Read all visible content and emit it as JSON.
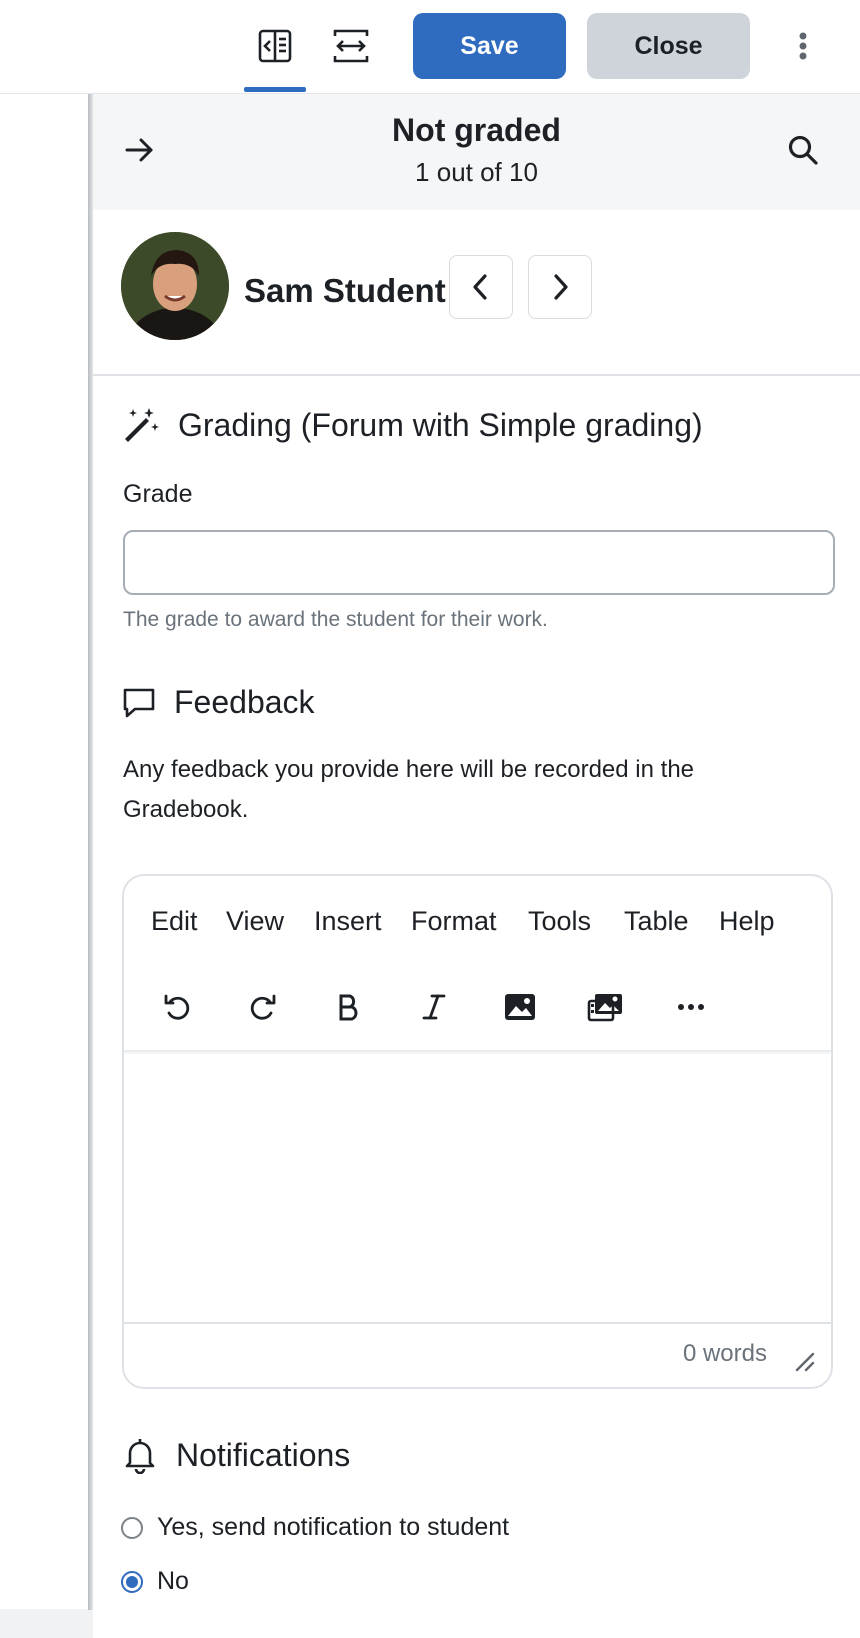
{
  "topbar": {
    "save_label": "Save",
    "close_label": "Close"
  },
  "panel": {
    "status_title": "Not graded",
    "status_sub": "1 out of 10",
    "student_name": "Sam Student"
  },
  "grading": {
    "heading": "Grading (Forum with Simple grading)",
    "grade_label": "Grade",
    "grade_value": "",
    "grade_help": "The grade to award the student for their work."
  },
  "feedback": {
    "heading": "Feedback",
    "description": "Any feedback you provide here will be recorded in the Gradebook.",
    "menu": [
      "Edit",
      "View",
      "Insert",
      "Format",
      "Tools",
      "Table",
      "Help"
    ],
    "tools": [
      "undo-icon",
      "redo-icon",
      "bold-icon",
      "italic-icon",
      "image-icon",
      "media-icon",
      "more-icon"
    ],
    "word_count": "0 words"
  },
  "notifications": {
    "heading": "Notifications",
    "options": [
      "Yes, send notification to student",
      "No"
    ],
    "selected": "No"
  },
  "colors": {
    "primary": "#2f6bbf",
    "secondary": "#ced4da"
  }
}
